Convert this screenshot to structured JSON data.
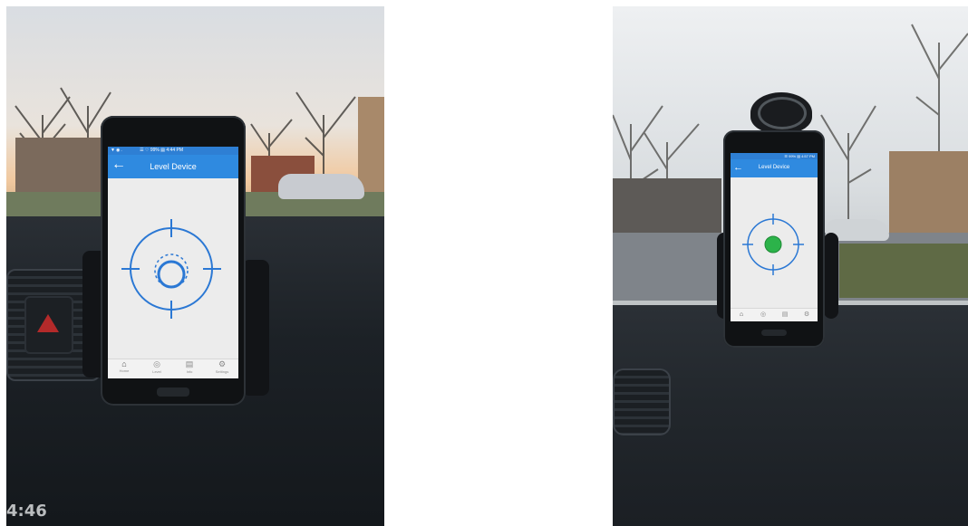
{
  "left_screen": {
    "status_text": "▼ ◉ .                   ☰ ♡ 99% ▤ 4:44 PM",
    "title": "Level Device",
    "tabs": [
      {
        "label": "Home",
        "icon": "home-icon"
      },
      {
        "label": "Level",
        "icon": "level-icon"
      },
      {
        "label": "Info",
        "icon": "info-icon"
      },
      {
        "label": "Settings",
        "icon": "gear-icon"
      }
    ]
  },
  "right_screen": {
    "status_text": "☰ 99% ▤ 4:57 PM",
    "title": "Level Device",
    "tabs": [
      {
        "icon": "home-icon"
      },
      {
        "icon": "level-icon"
      },
      {
        "icon": "info-icon"
      },
      {
        "icon": "gear-icon"
      }
    ]
  },
  "dashboard_clock": "4:46",
  "colors": {
    "app_bar_blue": "#2f8ae0",
    "crosshair_blue": "#2b78d4",
    "level_ok_green": "#2cb34a"
  }
}
